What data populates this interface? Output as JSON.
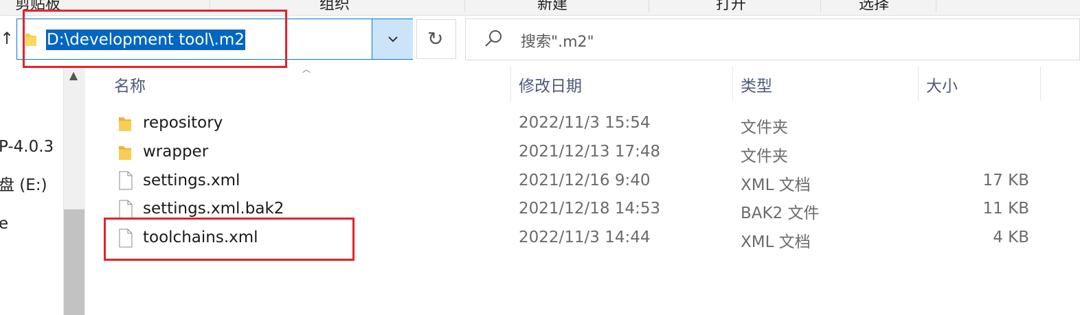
{
  "ribbon": {
    "groups": [
      "剪贴板",
      "组织",
      "新建",
      "打开",
      "选择"
    ]
  },
  "address_bar": {
    "path": "D:\\development tool\\.m2"
  },
  "search": {
    "placeholder": "搜索\".m2\""
  },
  "nav_pane": {
    "items": [
      "P-4.0.3",
      "盘 (E:)",
      "e"
    ]
  },
  "columns": {
    "name": "名称",
    "date": "修改日期",
    "type": "类型",
    "size": "大小"
  },
  "files": [
    {
      "icon": "folder-icon",
      "name": "repository",
      "date": "2022/11/3 15:54",
      "type": "文件夹",
      "size": ""
    },
    {
      "icon": "folder-icon",
      "name": "wrapper",
      "date": "2021/12/13 17:48",
      "type": "文件夹",
      "size": ""
    },
    {
      "icon": "file-icon",
      "name": "settings.xml",
      "date": "2021/12/16 9:40",
      "type": "XML 文档",
      "size": "17 KB"
    },
    {
      "icon": "file-icon",
      "name": "settings.xml.bak2",
      "date": "2021/12/18 14:53",
      "type": "BAK2 文件",
      "size": "11 KB"
    },
    {
      "icon": "file-icon",
      "name": "toolchains.xml",
      "date": "2022/11/3 14:44",
      "type": "XML 文档",
      "size": "4 KB"
    }
  ],
  "colors": {
    "selection": "#0067c0",
    "dropdown_bg": "#cce4f7",
    "highlight": "#e8202a",
    "folder": "#f8c94a"
  }
}
